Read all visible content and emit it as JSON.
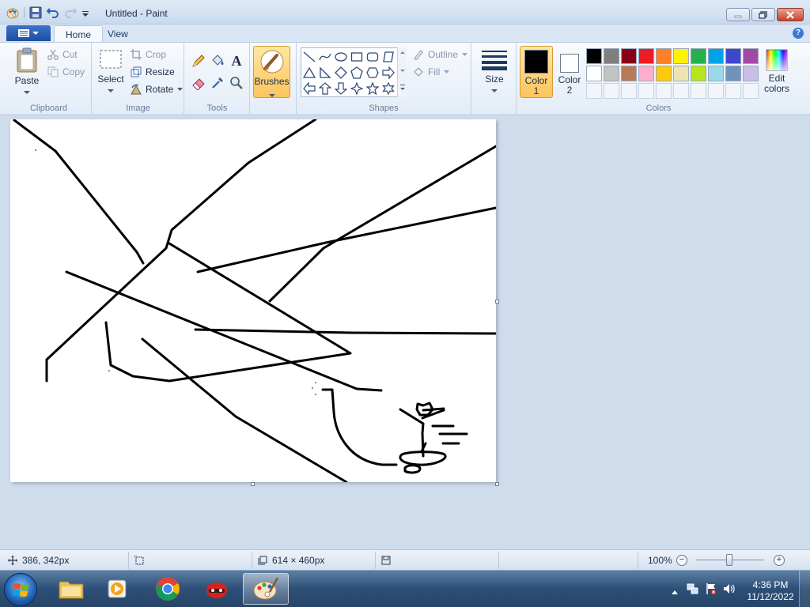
{
  "window": {
    "title": "Untitled - Paint"
  },
  "tabs": {
    "home": "Home",
    "view": "View"
  },
  "clipboard": {
    "label": "Clipboard",
    "paste": "Paste",
    "cut": "Cut",
    "copy": "Copy"
  },
  "image": {
    "label": "Image",
    "select": "Select",
    "crop": "Crop",
    "resize": "Resize",
    "rotate": "Rotate"
  },
  "tools": {
    "label": "Tools",
    "text_tool_glyph": "A"
  },
  "brushes": {
    "label": "Brushes"
  },
  "shapes": {
    "label": "Shapes",
    "outline": "Outline",
    "fill": "Fill"
  },
  "size": {
    "label": "Size"
  },
  "colors": {
    "label": "Colors",
    "color1_label": "Color",
    "color1_num": "1",
    "color2_label": "Color",
    "color2_num": "2",
    "edit_label": "Edit",
    "edit_label2": "colors",
    "color1_value": "#000000",
    "color2_value": "#ffffff",
    "palette_row1": [
      "#000000",
      "#7f7f7f",
      "#880015",
      "#ed1c24",
      "#ff7f27",
      "#fff200",
      "#22b14c",
      "#00a2e8",
      "#3f48cc",
      "#a349a4"
    ],
    "palette_row2": [
      "#ffffff",
      "#c3c3c3",
      "#b97a57",
      "#ffaec9",
      "#ffc90e",
      "#efe4b0",
      "#b5e61d",
      "#99d9ea",
      "#7092be",
      "#c8bfe7"
    ]
  },
  "status": {
    "cursor_pos": "386, 342px",
    "canvas_size": "614 × 460px",
    "zoom": "100%",
    "zoom_level": 100
  },
  "taskbar": {
    "time": "4:36 PM",
    "date": "11/12/2022"
  }
}
